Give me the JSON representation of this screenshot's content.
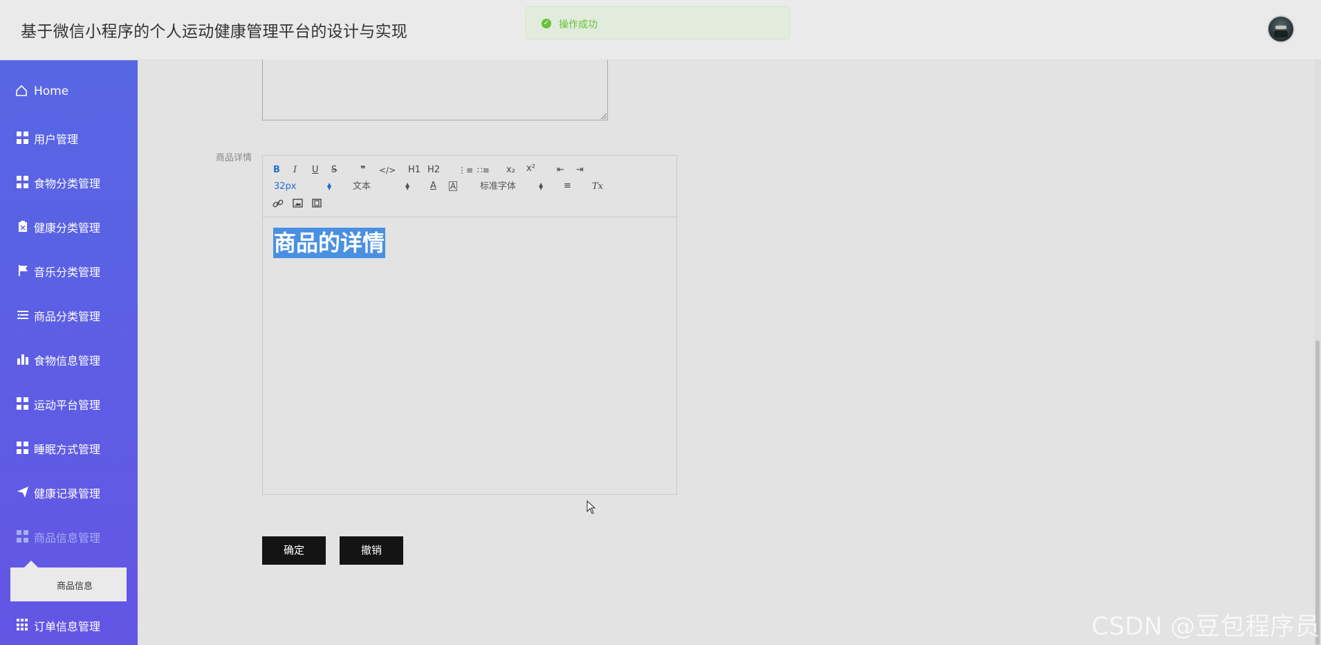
{
  "header": {
    "title": "基于微信小程序的个人运动健康管理平台的设计与实现"
  },
  "toast": {
    "message": "操作成功"
  },
  "sidebar": {
    "items": [
      {
        "label": "Home",
        "icon": "home-icon"
      },
      {
        "label": "用户管理",
        "icon": "grid-icon"
      },
      {
        "label": "食物分类管理",
        "icon": "grid-icon"
      },
      {
        "label": "健康分类管理",
        "icon": "clipboard-icon"
      },
      {
        "label": "音乐分类管理",
        "icon": "flag-icon"
      },
      {
        "label": "商品分类管理",
        "icon": "list-icon"
      },
      {
        "label": "食物信息管理",
        "icon": "bar-chart-icon"
      },
      {
        "label": "运动平台管理",
        "icon": "grid-icon"
      },
      {
        "label": "睡眠方式管理",
        "icon": "grid-icon"
      },
      {
        "label": "健康记录管理",
        "icon": "send-icon"
      },
      {
        "label": "商品信息管理",
        "icon": "grid-icon"
      },
      {
        "label": "订单信息管理",
        "icon": "grid9-icon"
      }
    ],
    "submenu": {
      "label": "商品信息"
    }
  },
  "form": {
    "detail_label": "商品详情",
    "editor": {
      "toolbar": {
        "bold": "B",
        "italic": "I",
        "underline": "U",
        "strike": "S",
        "quote": "❞",
        "code": "</>",
        "h1": "H1",
        "h2": "H2",
        "ordered_list": "⋮≡",
        "bullet_list": "∷≡",
        "subscript": "x₂",
        "superscript": "x²",
        "outdent": "⇤",
        "indent": "⇥",
        "size_value": "32px",
        "header_value": "文本",
        "color": "A",
        "background": "A",
        "font_value": "标准字体",
        "align": "≡",
        "clean": "Tx"
      },
      "content": "商品的详情"
    },
    "confirm_label": "确定",
    "cancel_label": "撤销"
  },
  "watermark": "CSDN @豆包程序员",
  "colors": {
    "sidebar_top": "#5767e4",
    "sidebar_bottom": "#6355e4",
    "toast_text": "#67c23a",
    "highlight": "#4a90e2",
    "button": "#141414"
  }
}
